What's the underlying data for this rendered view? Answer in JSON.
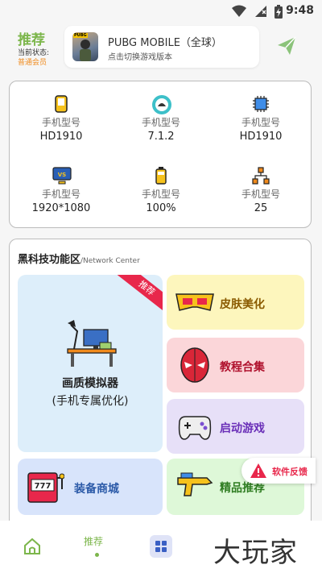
{
  "status_bar": {
    "time": "9:48",
    "icons": [
      "wifi-icon",
      "signal-icon",
      "battery-charging-icon"
    ]
  },
  "header": {
    "title": "推荐",
    "status_label": "当前状态:",
    "member_status": "普通会员",
    "game": {
      "name": "PUBG MOBILE（全球）",
      "subtitle": "点击切换游戏版本",
      "thumb_tag": "PUBG"
    },
    "send_icon": "paper-plane-icon",
    "colors": {
      "accent": "#7cb64b",
      "member": "#f08a1c"
    }
  },
  "device_info": [
    {
      "icon": "phone-icon",
      "label": "手机型号",
      "value": "HD1910"
    },
    {
      "icon": "android-icon",
      "label": "手机型号",
      "value": "7.1.2"
    },
    {
      "icon": "cpu-icon",
      "label": "手机型号",
      "value": "HD1910"
    },
    {
      "icon": "monitor-icon",
      "label": "手机型号",
      "value": "1920*1080"
    },
    {
      "icon": "battery-icon",
      "label": "手机型号",
      "value": "100%"
    },
    {
      "icon": "network-icon",
      "label": "手机型号",
      "value": "25"
    }
  ],
  "function_area": {
    "title": "黑科技功能区",
    "subtitle": "/Network Center",
    "featured": {
      "ribbon": "推荐",
      "line1": "画质模拟器",
      "line2": "(手机专属优化)",
      "icon": "desk-lamp-icon"
    },
    "tiles": [
      {
        "label": "皮肤美化",
        "icon": "goggles-icon",
        "bg": "#fdf6bd",
        "color": "#8a5a00"
      },
      {
        "label": "教程合集",
        "icon": "mask-hero-icon",
        "bg": "#fbd6d9",
        "color": "#b0122e"
      },
      {
        "label": "启动游戏",
        "icon": "gamepad-icon",
        "bg": "#e7e0f8",
        "color": "#6a2fb8"
      },
      {
        "label": "装备商城",
        "icon": "slot-machine-icon"
      },
      {
        "label": "精品推荐",
        "icon": "water-gun-icon",
        "bg": "#def8d8",
        "color": "#2f7d22"
      }
    ]
  },
  "feedback": {
    "label": "软件反馈",
    "icon": "warning-icon"
  },
  "bottom_nav": {
    "home_icon": "home-icon",
    "recommend": "推荐",
    "grid_icon": "grid-icon",
    "watermark": "大玩家"
  }
}
